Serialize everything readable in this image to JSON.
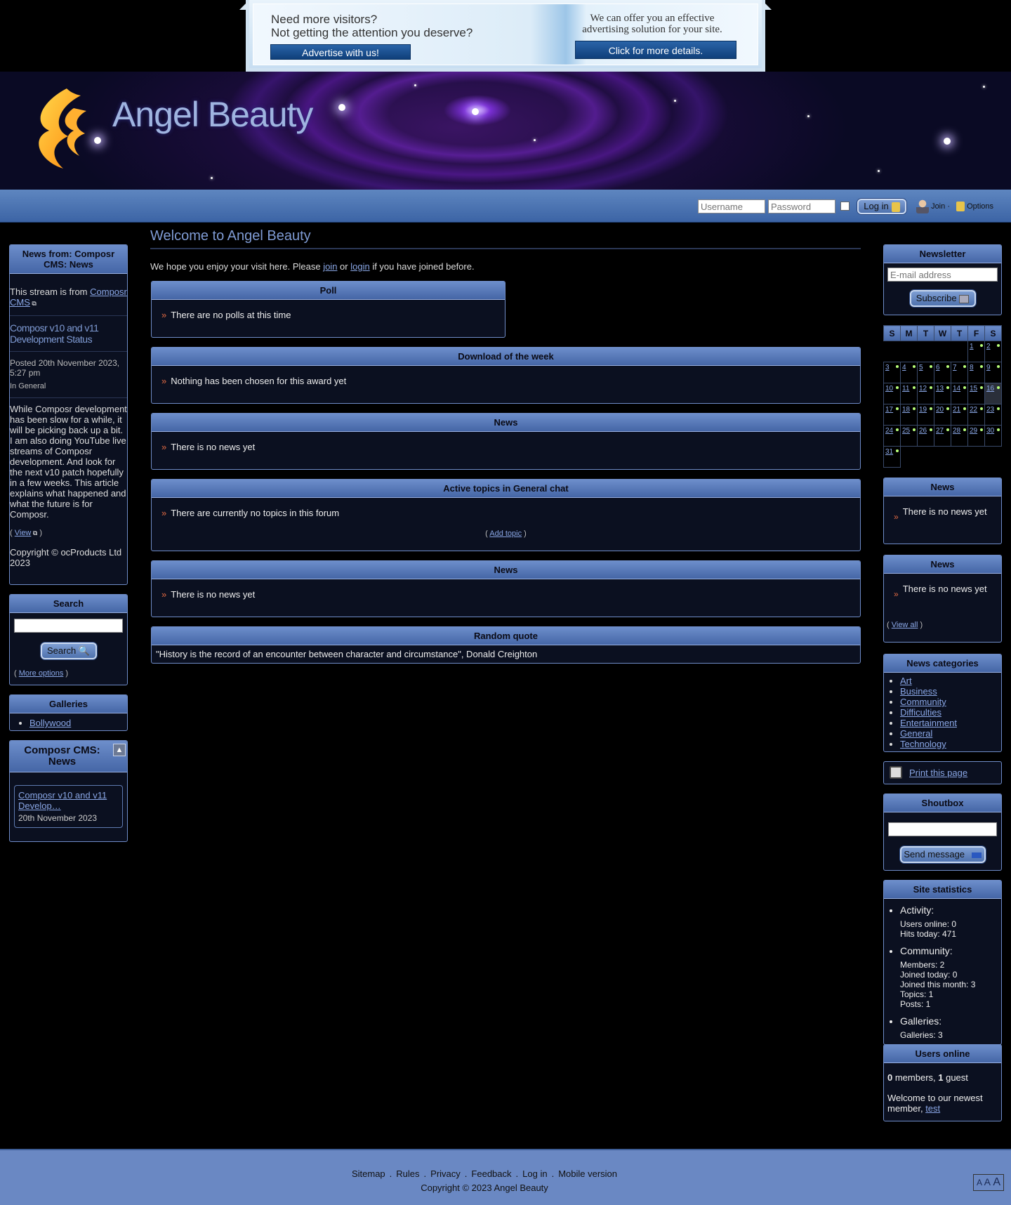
{
  "banner": {
    "line1": "Need more visitors?",
    "line2": "Not getting the attention you deserve?",
    "button_left": "Advertise with us!",
    "right_line1": "We can offer you an effective",
    "right_line2": "advertising solution for your site.",
    "button_right": "Click for more details."
  },
  "site": {
    "name": "Angel Beauty"
  },
  "login": {
    "username_placeholder": "Username",
    "password_placeholder": "Password",
    "login_button": "Log in",
    "join_label": "Join",
    "options_label": "Options"
  },
  "left": {
    "stream": {
      "title": "News from: Composr CMS: News",
      "source_prefix": "This stream is from ",
      "source_link": "Composr CMS",
      "article_title": "Composr v10 and v11 Development Status",
      "posted": "Posted 20th November 2023, 5:27 pm",
      "category": "In General",
      "body": "While Composr development has been slow for a while, it will be picking back up a bit. I am also doing YouTube live streams of Composr development. And look for the next v10 patch hopefully in a few weeks. This article explains what happened and what the future is for Composr.",
      "view_link": "View",
      "copyright": "Copyright © ocProducts Ltd 2023"
    },
    "search": {
      "title": "Search",
      "button": "Search",
      "more_options": "More options"
    },
    "galleries": {
      "title": "Galleries",
      "items": [
        "Bollywood"
      ]
    },
    "composr_news": {
      "title": "Composr CMS: News",
      "item_title": "Composr v10 and v11 Develop…",
      "item_date": "20th November 2023"
    }
  },
  "main": {
    "title": "Welcome to Angel Beauty",
    "intro_before": "We hope you enjoy your visit here. Please ",
    "intro_join": "join",
    "intro_or": " or ",
    "intro_login": "login",
    "intro_after": " if you have joined before.",
    "poll": {
      "title": "Poll",
      "text": "There are no polls at this time"
    },
    "download": {
      "title": "Download of the week",
      "text": "Nothing has been chosen for this award yet"
    },
    "news1": {
      "title": "News",
      "text": "There is no news yet"
    },
    "topics": {
      "title": "Active topics in General chat",
      "text": "There are currently no topics in this forum",
      "add_topic": "Add topic"
    },
    "news2": {
      "title": "News",
      "text": "There is no news yet"
    },
    "quote": {
      "title": "Random quote",
      "text": "\"History is the record of an encounter between character and circumstance\", Donald Creighton"
    }
  },
  "right": {
    "newsletter": {
      "title": "Newsletter",
      "email_placeholder": "E-mail address",
      "button": "Subscribe"
    },
    "calendar": {
      "headers": [
        "S",
        "M",
        "T",
        "W",
        "T",
        "F",
        "S"
      ],
      "weeks": [
        [
          "",
          "",
          "",
          "",
          "",
          "1",
          "2"
        ],
        [
          "3",
          "4",
          "5",
          "6",
          "7",
          "8",
          "9"
        ],
        [
          "10",
          "11",
          "12",
          "13",
          "14",
          "15",
          "16"
        ],
        [
          "17",
          "18",
          "19",
          "20",
          "21",
          "22",
          "23"
        ],
        [
          "24",
          "25",
          "26",
          "27",
          "28",
          "29",
          "30"
        ],
        [
          "31",
          "",
          "",
          "",
          "",
          "",
          ""
        ]
      ]
    },
    "news_a": {
      "title": "News",
      "text": "There is no news yet"
    },
    "news_b": {
      "title": "News",
      "text": "There is no news yet",
      "view_all": "View all"
    },
    "categories": {
      "title": "News categories",
      "items": [
        "Art",
        "Business",
        "Community",
        "Difficulties",
        "Entertainment",
        "General",
        "Technology"
      ]
    },
    "print": {
      "label": "Print this page"
    },
    "shoutbox": {
      "title": "Shoutbox",
      "button": "Send message"
    },
    "stats": {
      "title": "Site statistics",
      "activity_label": "Activity:",
      "users_online": "Users online:  0",
      "hits_today": "Hits today:  471",
      "community_label": "Community:",
      "members": "Members:  2",
      "joined_today": "Joined today:  0",
      "joined_month": "Joined this month:  3",
      "topics": "Topics:  1",
      "posts": "Posts:  1",
      "galleries_label": "Galleries:",
      "galleries": "Galleries:  3"
    },
    "users_online": {
      "title": "Users online",
      "members_count": "0",
      "members_text": " members, ",
      "guest_count": "1",
      "guest_text": " guest",
      "welcome": "Welcome to our newest member, ",
      "newest": "test"
    }
  },
  "footer": {
    "links": [
      "Sitemap",
      "Rules",
      "Privacy",
      "Feedback",
      "Log in",
      "Mobile version"
    ],
    "copyright": "Copyright © 2023 Angel Beauty",
    "font_sizer": [
      "A",
      "A",
      "A"
    ]
  }
}
